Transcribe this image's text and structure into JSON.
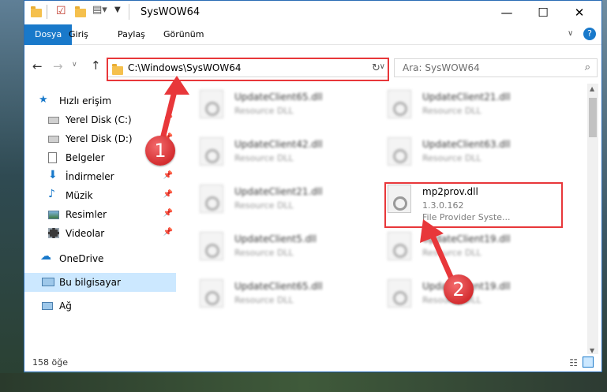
{
  "window": {
    "title": "SysWOW64"
  },
  "ribbon": {
    "tabs": [
      "Dosya",
      "Giriş",
      "Paylaş",
      "Görünüm"
    ]
  },
  "nav": {
    "address": "C:\\Windows\\SysWOW64",
    "search_placeholder": "Ara: SysWOW64"
  },
  "sidebar": {
    "items": [
      {
        "label": "Hızlı erişim",
        "icon": "star-icon"
      },
      {
        "label": "Yerel Disk (C:)",
        "icon": "drive-icon"
      },
      {
        "label": "Yerel Disk (D:)",
        "icon": "drive-icon"
      },
      {
        "label": "Belgeler",
        "icon": "documents-icon"
      },
      {
        "label": "İndirmeler",
        "icon": "download-icon"
      },
      {
        "label": "Müzik",
        "icon": "music-icon"
      },
      {
        "label": "Resimler",
        "icon": "pictures-icon"
      },
      {
        "label": "Videolar",
        "icon": "videos-icon"
      },
      {
        "label": "OneDrive",
        "icon": "cloud-icon"
      },
      {
        "label": "Bu bilgisayar",
        "icon": "computer-icon"
      },
      {
        "label": "Ağ",
        "icon": "network-icon"
      }
    ]
  },
  "files": [
    {
      "name": "UpdateClient65.dll",
      "desc": "Resource DLL"
    },
    {
      "name": "UpdateClient21.dll",
      "desc": "Resource DLL"
    },
    {
      "name": "UpdateClient42.dll",
      "desc": "Resource DLL"
    },
    {
      "name": "UpdateClient63.dll",
      "desc": "Resource DLL"
    },
    {
      "name": "UpdateClient21.dll",
      "desc": "Resource DLL"
    },
    {
      "name": "mp2prov.dll",
      "version": "1.3.0.162",
      "desc": "File Provider Syste..."
    },
    {
      "name": "UpdateClient5.dll",
      "desc": "Resource DLL"
    },
    {
      "name": "UpdateClient19.dll",
      "desc": "Resource DLL"
    },
    {
      "name": "UpdateClient65.dll",
      "desc": "Resource DLL"
    },
    {
      "name": "UpdateClient19.dll",
      "desc": "Resource DLL"
    }
  ],
  "status": {
    "count": "158 öğe"
  },
  "annotations": {
    "badge1": "1",
    "badge2": "2"
  },
  "colors": {
    "accent": "#1979ca",
    "highlight": "#e8373a"
  }
}
